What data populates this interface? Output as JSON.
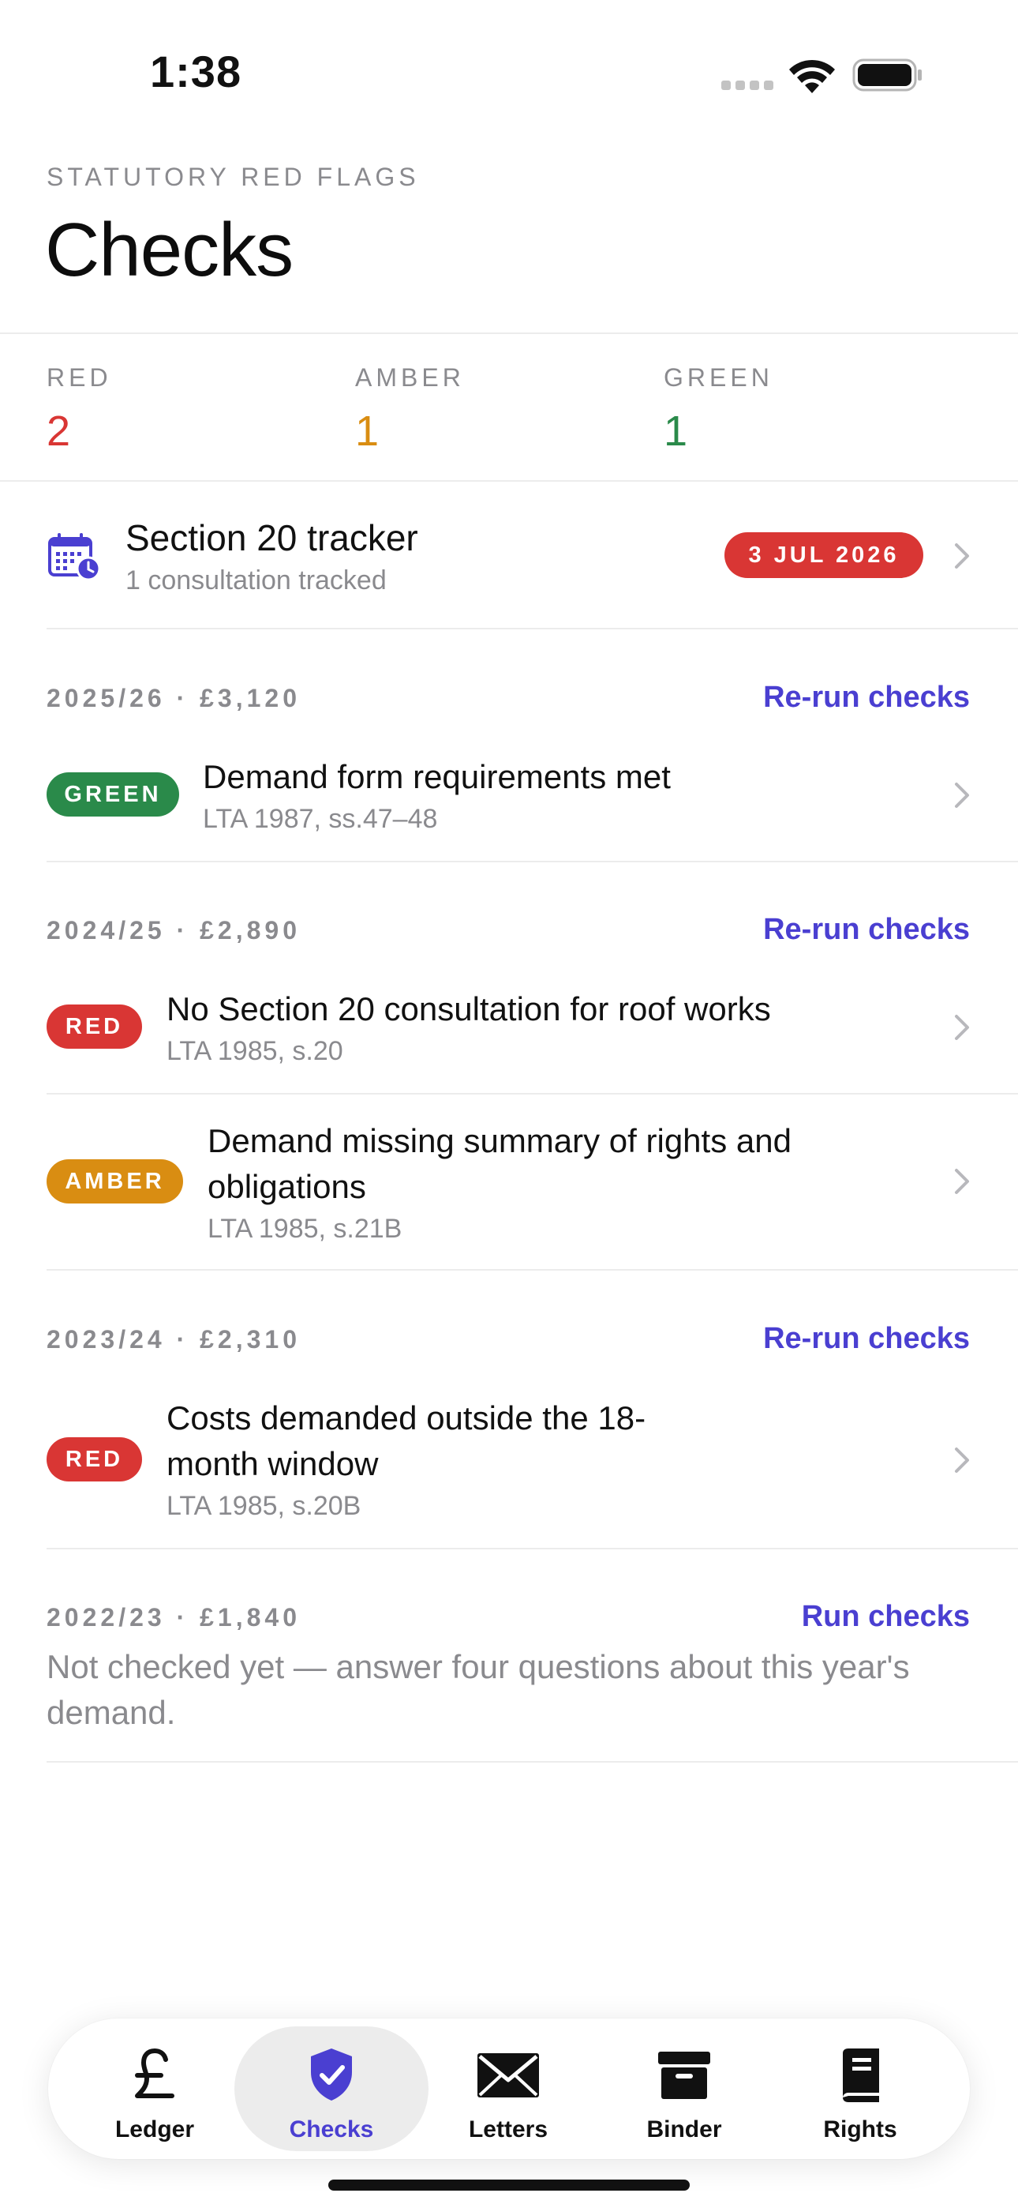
{
  "status_bar": {
    "time": "1:38"
  },
  "header": {
    "eyebrow": "STATUTORY RED FLAGS",
    "title": "Checks"
  },
  "counts": [
    {
      "label": "RED",
      "value": "2",
      "color": "#d93634"
    },
    {
      "label": "AMBER",
      "value": "1",
      "color": "#d98d12"
    },
    {
      "label": "GREEN",
      "value": "1",
      "color": "#2a8a4a"
    }
  ],
  "section20": {
    "title": "Section 20 tracker",
    "subtitle": "1 consultation tracked",
    "date": "3 JUL 2026",
    "icon": "calendar-clock-icon"
  },
  "years": [
    {
      "label": "2025/26 · £3,120",
      "action": "Re-run checks",
      "items": [
        {
          "status": "GREEN",
          "title": "Demand form requirements met",
          "ref": "LTA 1987, ss.47–48"
        }
      ]
    },
    {
      "label": "2024/25 · £2,890",
      "action": "Re-run checks",
      "items": [
        {
          "status": "RED",
          "title": "No Section 20 consultation for roof works",
          "ref": "LTA 1985, s.20"
        },
        {
          "status": "AMBER",
          "title_lines": [
            "Demand missing summary of rights and",
            "obligations"
          ],
          "ref": "LTA 1985, s.21B"
        }
      ]
    },
    {
      "label": "2023/24 · £2,310",
      "action": "Re-run checks",
      "items": [
        {
          "status": "RED",
          "title_lines": [
            "Costs demanded outside the 18-",
            "month window"
          ],
          "ref": "LTA 1985, s.20B"
        }
      ]
    },
    {
      "label": "2022/23 · £1,840",
      "action": "Run checks",
      "note": "Not checked yet — answer four questions about this year's demand."
    }
  ],
  "tabs": [
    {
      "label": "Ledger",
      "icon": "pound-icon",
      "active": false
    },
    {
      "label": "Checks",
      "icon": "shield-check-icon",
      "active": true
    },
    {
      "label": "Letters",
      "icon": "envelope-icon",
      "active": false
    },
    {
      "label": "Binder",
      "icon": "archive-box-icon",
      "active": false
    },
    {
      "label": "Rights",
      "icon": "book-icon",
      "active": false
    }
  ],
  "colors": {
    "accent": "#4a3fd1",
    "red": "#d93634",
    "amber": "#d98d12",
    "green": "#2a8a4a",
    "muted": "#8a8a8e"
  }
}
